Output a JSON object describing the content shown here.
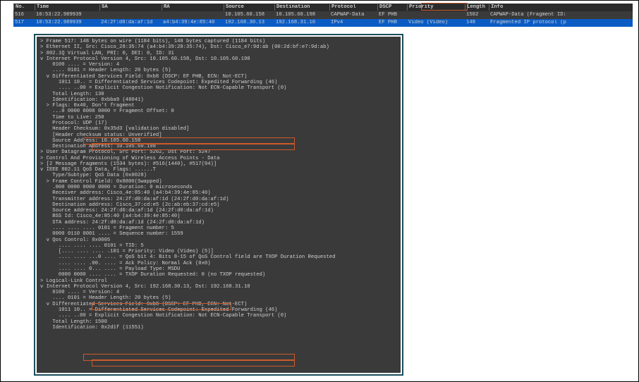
{
  "columns": {
    "no": "No.",
    "time": "Time",
    "sa": "SA",
    "ra": "RA",
    "src": "Source",
    "dst": "Destination",
    "proto": "Protocol",
    "dscp": "DSCP",
    "prio": "Priority",
    "len": "Length",
    "info": "Info"
  },
  "rows": [
    {
      "no": "516",
      "time": "10:53:22.989939",
      "sa": "",
      "ra": "",
      "src": "10.105.60.158",
      "dst": "10.105.60.198",
      "proto": "CAPWAP-Data",
      "dscp": "EF PHB",
      "prio": "",
      "len": "1502",
      "info": "CAPWAP-Data (Fragment ID:"
    },
    {
      "no": "517",
      "time": "10:53:22.989939",
      "sa": "24:2f:d0:da:af:1d",
      "ra": "a4:b4:39:4e:85:40",
      "src": "192.168.30.13",
      "dst": "192.168.31.10",
      "proto": "IPv4",
      "dscp": "EF PHB",
      "prio": "Video (Video)",
      "len": "148",
      "info": "Fragmented IP protocol (p"
    }
  ],
  "d": {
    "l0": "> Frame 517: 148 bytes on wire (1184 bits), 148 bytes captured (1184 bits)",
    "l1": "> Ethernet II, Src: Cisco_28:35:74 (a4:b4:39:28:35:74), Dst: Cisco_e7:9d:ab (00:2d:bf:e7:9d:ab)",
    "l2": "> 802.1Q Virtual LAN, PRI: 0, DEI: 0, ID: 31",
    "l3": "v Internet Protocol Version 4, Src: 10.105.60.158, Dst: 10.105.60.198",
    "l4": "    0100 .... = Version: 4",
    "l5": "    .... 0101 = Header Length: 20 bytes (5)",
    "l6": "  v Differentiated Services Field: 0xb8 (DSCP: EF PHB, ECN: Not-ECT)",
    "l7": "      1011 10.. = Differentiated Services Codepoint: Expedited Forwarding (46)",
    "l8": "      .... ..00 = Explicit Congestion Notification: Not ECN-Capable Transport (0)",
    "l9": "    Total Length: 130",
    "l10": "    Identification: 0xbba9 (48041)",
    "l11": "  > Flags: 0x40, Don't fragment",
    "l12": "    ...0 0000 0000 0000 = Fragment Offset: 0",
    "l13": "    Time to Live: 250",
    "l14": "    Protocol: UDP (17)",
    "l15": "    Header Checksum: 0x35d3 [validation disabled]",
    "l16": "    [Header checksum status: Unverified]",
    "l17": "    Source Address: 10.105.60.158",
    "l18": "    Destination Address: 10.105.60.198",
    "l19": "> User Datagram Protocol, Src Port: 5262, Dst Port: 5247",
    "l20": "> Control And Provisioning of Wireless Access Points - Data",
    "l21": "> [2 Message fragments (1534 bytes): #516(1440), #517(94)]",
    "l22": "v IEEE 802.11 QoS Data, Flags: ......T",
    "l23": "    Type/Subtype: QoS Data (0x0028)",
    "l24": "  > Frame Control Field: 0x8800(Swapped)",
    "l25": "    .000 0000 0000 0000 = Duration: 0 microseconds",
    "l26": "    Receiver address: Cisco_4e:85:40 (a4:b4:39:4e:85:40)",
    "l27": "    Transmitter address: 24:2f:d0:da:af:1d (24:2f:d0:da:af:1d)",
    "l28": "    Destination address: Cisco_37:cd:e5 (2c:ab:eb:37:cd:e5)",
    "l29": "    Source address: 24:2f:d0:da:af:1d (24:2f:d0:da:af:1d)",
    "l30": "    BSS Id: Cisco_4e:85:40 (a4:b4:39:4e:85:40)",
    "l31": "    STA address: 24:2f:d0:da:af:1d (24:2f:d0:da:af:1d)",
    "l32": "    .... .... .... 0101 = Fragment number: 5",
    "l33": "    0000 0110 0001 .... = Sequence number: 1559",
    "l34": "  v Qos Control: 0x0005",
    "l35": "      .... .... .... 0101 = TID: 5",
    "l36": "      [.... .... .... .101 = Priority: Video (Video) (5)]",
    "l37": "      .... .... ...0 .... = QoS bit 4: Bits 8-15 of QoS Control field are TXOP Duration Requested",
    "l38": "      .... .... .00. .... = Ack Policy: Normal Ack (0x0)",
    "l39": "      .... .... 0... .... = Payload Type: MSDU",
    "l40": "      0000 0000 .... .... = TXOP Duration Requested: 0 (no TXOP requested)",
    "l41": "> Logical-Link Control",
    "l42": "v Internet Protocol Version 4, Src: 192.168.30.13, Dst: 192.168.31.10",
    "l43": "    0100 .... = Version: 4",
    "l44": "    .... 0101 = Header Length: 20 bytes (5)",
    "l45": "  v Differentiated Services Field: 0xb8 (DSCP: EF PHB, ECN: Not-ECT)",
    "l46": "      1011 10.. = Differentiated Services Codepoint: Expedited Forwarding (46)",
    "l47": "      .... ..00 = Explicit Congestion Notification: Not ECN-Capable Transport (0)",
    "l48": "    Total Length: 1500",
    "l49": "    Identification: 0x2d1f (11551)"
  }
}
